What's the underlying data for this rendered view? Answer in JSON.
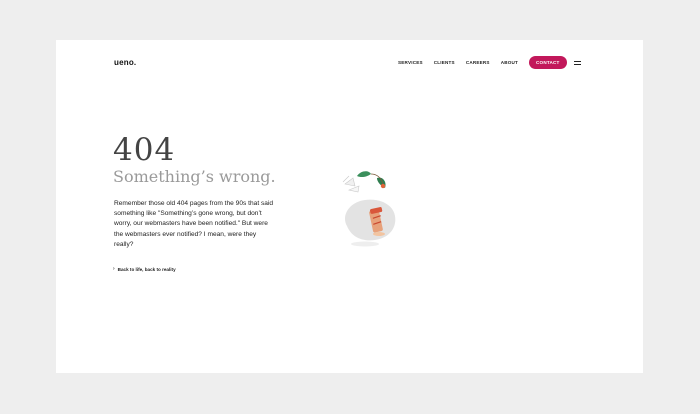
{
  "header": {
    "logo": "ueno.",
    "nav": [
      "SERVICES",
      "CLIENTS",
      "CAREERS",
      "ABOUT"
    ],
    "contact_label": "CONTACT"
  },
  "error": {
    "code": "404",
    "title": "Something’s wrong.",
    "message": "Remember those old 404 pages from the 90s that said something like \"Something’s gone wrong, but don’t worry, our webmasters have been notified.\" But were the webmasters ever notified? I mean, were they really?",
    "back_link": "Back to life, back to reality"
  },
  "colors": {
    "background": "#eeeeee",
    "page": "#ffffff",
    "accent": "#c2185b"
  }
}
